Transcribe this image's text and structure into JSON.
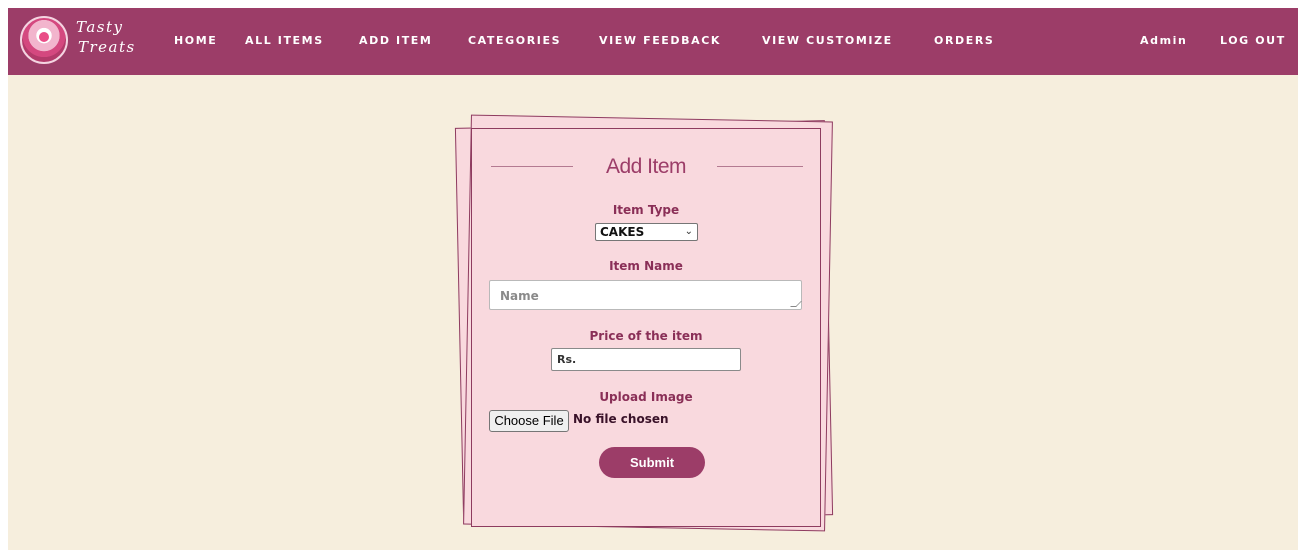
{
  "brand": {
    "line1": "Tasty",
    "line2": "Treats"
  },
  "nav": {
    "home": "HOME",
    "all_items": "ALL ITEMS",
    "add_item": "ADD ITEM",
    "categories": "CATEGORIES",
    "view_feedback": "VIEW FEEDBACK",
    "view_customize": "VIEW CUSTOMIZE",
    "orders": "ORDERS",
    "admin": "Admin",
    "logout": "LOG OUT"
  },
  "form": {
    "title": "Add Item",
    "item_type_label": "Item Type",
    "item_type_value": "CAKES",
    "item_name_label": "Item Name",
    "item_name_placeholder": "Name",
    "price_label": "Price of the item",
    "price_placeholder": "Rs.",
    "upload_label": "Upload Image",
    "choose_file": "Choose File",
    "file_status": "No file chosen",
    "submit": "Submit"
  },
  "colors": {
    "navbar": "#9c3d68",
    "page_background": "#f6eedd",
    "card": "#f9d9de",
    "label": "#8a2f57"
  }
}
